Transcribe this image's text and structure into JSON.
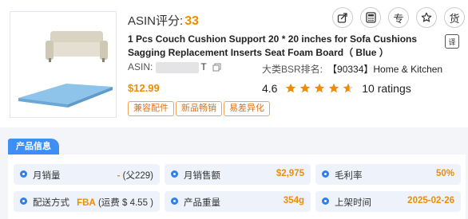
{
  "header": {
    "asin_score_label": "ASIN评分:",
    "asin_score_value": "33"
  },
  "toolbar": {
    "buttons": [
      {
        "name": "share-icon"
      },
      {
        "name": "calculator-icon"
      },
      {
        "name": "specialty-button",
        "label": "专"
      },
      {
        "name": "star-icon"
      },
      {
        "name": "source-button",
        "label": "货"
      }
    ],
    "translate_label": "译"
  },
  "product": {
    "title": "1 Pcs Couch Cushion Support 20 * 20 inches for Sofa Cushions Sagging Replacement Inserts Seat Foam Board（ Blue ）",
    "asin_label": "ASIN:",
    "asin_tail": "T",
    "bsr_label": "大类BSR排名:",
    "bsr_value": "【90334】Home & Kitchen",
    "price": "$12.99",
    "rating": "4.6",
    "ratings_count": "10 ratings",
    "stars": 4.6
  },
  "tags": [
    "兼容配件",
    "新品畅销",
    "易差异化"
  ],
  "section": {
    "title": "产品信息"
  },
  "stats": [
    {
      "label": "月销量",
      "value": "-",
      "sub": " (父229)"
    },
    {
      "label": "月销售额",
      "value": "$2,975"
    },
    {
      "label": "毛利率",
      "value": "50%"
    },
    {
      "label": "配送方式",
      "value": "FBA",
      "sub": " (运费 $ 4.55 )"
    },
    {
      "label": "产品重量",
      "value": "354g"
    },
    {
      "label": "上架时间",
      "value": "2025-02-26"
    }
  ],
  "colors": {
    "accent": "#f08c00",
    "tab_blue": "#3f8ef5",
    "tag_border": "#f0a45a"
  }
}
